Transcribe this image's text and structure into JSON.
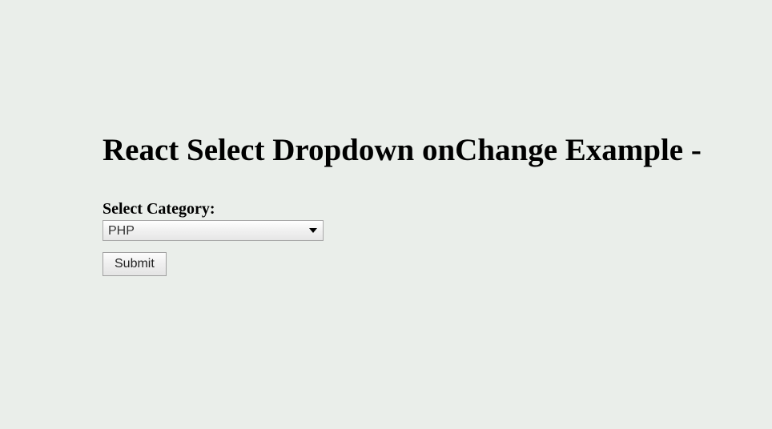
{
  "page": {
    "title": "React Select Dropdown onChange Example -"
  },
  "form": {
    "category_label": "Select Category:",
    "category_selected": "PHP",
    "submit_label": "Submit"
  }
}
